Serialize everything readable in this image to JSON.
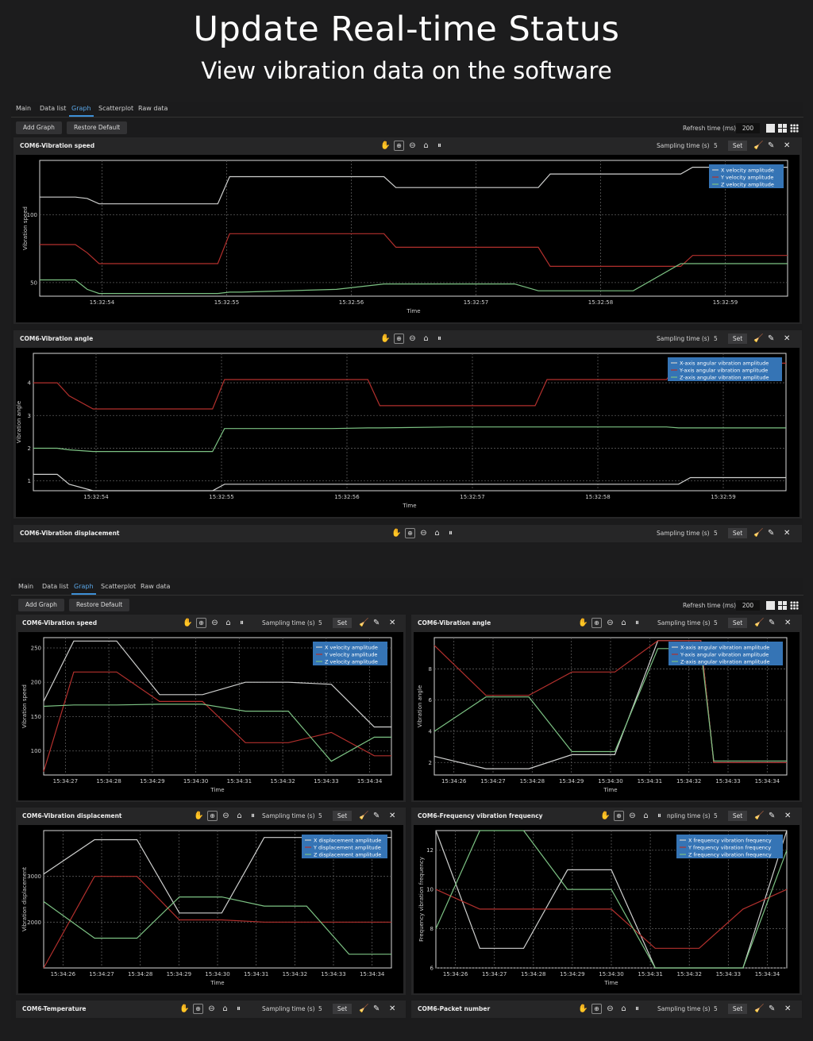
{
  "header": {
    "title": "Update Real-time Status",
    "subtitle": "View vibration data on the software"
  },
  "tabs": [
    "Main",
    "Data list",
    "Graph",
    "Scatterplot",
    "Raw data"
  ],
  "active_tab": "Graph",
  "toolbar": {
    "add_graph": "Add Graph",
    "restore_default": "Restore Default",
    "refresh_label": "Refresh time (ms)",
    "refresh_value": "200"
  },
  "panel_common": {
    "sampling_label": "Sampling time (s)",
    "sampling_value": "5",
    "set_label": "Set",
    "time_axis_label": "Time"
  },
  "top_panels": {
    "speed_title": "COM6-Vibration speed",
    "angle_title": "COM6-Vibration angle",
    "displacement_title": "COM6-Vibration displacement"
  },
  "bottom_panels": {
    "speed_title": "COM6-Vibration speed",
    "angle_title": "COM6-Vibration angle",
    "displacement_title": "COM6-Vibration displacement",
    "frequency_title": "COM6-Frequency vibration frequency",
    "frequency_sampling_label": "npling time (s)",
    "temperature_title": "COM6-Temperature",
    "packet_title": "COM6-Packet number"
  },
  "colors": {
    "x_series": "#cfd0cf",
    "y_series": "#b3302d",
    "z_series": "#7cc283",
    "legend_bg": "#3574b5",
    "accent_tab": "#3d8fd6"
  },
  "chart_data": [
    {
      "id": "top-speed",
      "type": "line",
      "ylabel": "Vibration speed",
      "xlabel": "Time",
      "x_ticks": [
        "15:32:54",
        "15:32:55",
        "15:32:56",
        "15:32:57",
        "15:32:58",
        "15:32:59"
      ],
      "y_ticks": [
        "50",
        "100"
      ],
      "legend": [
        "X velocity amplitude",
        "Y velocity amplitude",
        "Z velocity amplitude"
      ],
      "x": [
        53.5,
        53.8,
        53.9,
        54.0,
        54.5,
        55.0,
        55.1,
        55.2,
        56.0,
        56.4,
        56.5,
        57.0,
        57.5,
        57.7,
        57.8,
        58.0,
        58.4,
        58.5,
        58.9,
        59.0,
        59.5,
        59.8
      ],
      "ylim": [
        40,
        140
      ],
      "series": [
        {
          "name": "X velocity amplitude",
          "values": [
            113,
            113,
            112,
            108,
            108,
            108,
            128,
            128,
            128,
            128,
            120,
            120,
            120,
            120,
            130,
            130,
            130,
            130,
            130,
            135,
            135,
            135
          ]
        },
        {
          "name": "Y velocity amplitude",
          "values": [
            78,
            78,
            72,
            64,
            64,
            64,
            86,
            86,
            86,
            86,
            76,
            76,
            76,
            76,
            62,
            62,
            62,
            62,
            62,
            70,
            70,
            70
          ]
        },
        {
          "name": "Z velocity amplitude",
          "values": [
            52,
            52,
            45,
            42,
            42,
            42,
            43,
            43,
            45,
            49,
            49,
            49,
            49,
            44,
            44,
            44,
            44,
            44,
            64,
            64,
            64,
            64
          ]
        }
      ]
    },
    {
      "id": "top-angle",
      "type": "line",
      "ylabel": "Vibration angle",
      "xlabel": "Time",
      "x_ticks": [
        "15:32:54",
        "15:32:55",
        "15:32:56",
        "15:32:57",
        "15:32:58",
        "15:32:59"
      ],
      "y_ticks": [
        "1",
        "2",
        "3",
        "4"
      ],
      "legend": [
        "X-axis angular vibration amplitude",
        "Y-axis angular vibration amplitude",
        "Z-axis angular vibration amplitude"
      ],
      "x": [
        53.5,
        53.7,
        53.8,
        54.0,
        54.5,
        55.0,
        55.1,
        55.2,
        56.0,
        56.3,
        56.4,
        57.0,
        57.5,
        57.7,
        57.8,
        58.0,
        58.5,
        58.8,
        58.9,
        59.0,
        59.5,
        59.8
      ],
      "ylim": [
        0.7,
        4.9
      ],
      "series": [
        {
          "name": "X-axis angular vibration amplitude",
          "values": [
            1.2,
            1.2,
            0.9,
            0.7,
            0.7,
            0.7,
            0.9,
            0.9,
            0.9,
            0.9,
            0.9,
            0.9,
            0.9,
            0.9,
            0.9,
            0.9,
            0.9,
            0.9,
            0.9,
            1.1,
            1.1,
            1.1
          ]
        },
        {
          "name": "Y-axis angular vibration amplitude",
          "values": [
            4.0,
            4.0,
            3.6,
            3.2,
            3.2,
            3.2,
            4.1,
            4.1,
            4.1,
            4.1,
            3.3,
            3.3,
            3.3,
            3.3,
            4.1,
            4.1,
            4.1,
            4.1,
            4.6,
            4.6,
            4.6,
            4.6
          ]
        },
        {
          "name": "Z-axis angular vibration amplitude",
          "values": [
            2.0,
            2.0,
            1.95,
            1.9,
            1.9,
            1.9,
            2.6,
            2.6,
            2.6,
            2.62,
            2.62,
            2.65,
            2.65,
            2.65,
            2.65,
            2.65,
            2.65,
            2.65,
            2.62,
            2.62,
            2.62,
            2.62
          ]
        }
      ]
    },
    {
      "id": "bottom-speed",
      "type": "line",
      "ylabel": "Vibration speed",
      "xlabel": "Time",
      "x_ticks": [
        "15:34:27",
        "15:34:28",
        "15:34:29",
        "15:34:30",
        "15:34:31",
        "15:34:32",
        "15:34:33",
        "15:34:34"
      ],
      "y_ticks": [
        "100",
        "150",
        "200",
        "250"
      ],
      "legend": [
        "X velocity amplitude",
        "Y velocity amplitude",
        "Z velocity amplitude"
      ],
      "x": [
        26.5,
        27.2,
        28.2,
        29.2,
        30.2,
        31.2,
        32.2,
        33.2,
        34.2,
        34.6
      ],
      "ylim": [
        65,
        265
      ],
      "series": [
        {
          "name": "X velocity amplitude",
          "values": [
            172,
            260,
            260,
            182,
            182,
            200,
            200,
            197,
            135,
            135
          ]
        },
        {
          "name": "Y velocity amplitude",
          "values": [
            70,
            215,
            215,
            172,
            172,
            112,
            112,
            127,
            93,
            93
          ]
        },
        {
          "name": "Z velocity amplitude",
          "values": [
            165,
            167,
            167,
            168,
            168,
            158,
            158,
            85,
            120,
            120
          ]
        }
      ]
    },
    {
      "id": "bottom-angle",
      "type": "line",
      "ylabel": "Vibration angle",
      "xlabel": "Time",
      "x_ticks": [
        "15:34:26",
        "15:34:27",
        "15:34:28",
        "15:34:29",
        "15:34:30",
        "15:34:31",
        "15:34:32",
        "15:34:33",
        "15:34:34"
      ],
      "y_ticks": [
        "2",
        "4",
        "6",
        "8"
      ],
      "legend": [
        "X-axis angular vibration amplitude",
        "Y-axis angular vibration amplitude",
        "Z-axis angular vibration amplitude"
      ],
      "x": [
        26.0,
        27.2,
        28.2,
        29.2,
        30.2,
        31.2,
        32.2,
        32.5,
        33.2,
        34.2
      ],
      "ylim": [
        1.2,
        10
      ],
      "series": [
        {
          "name": "X-axis angular vibration amplitude",
          "values": [
            2.4,
            1.6,
            1.6,
            2.5,
            2.5,
            9.8,
            9.8,
            2.0,
            2.0,
            2.0
          ]
        },
        {
          "name": "Y-axis angular vibration amplitude",
          "values": [
            9.5,
            6.3,
            6.3,
            7.8,
            7.8,
            9.8,
            9.8,
            2.0,
            2.0,
            2.0
          ]
        },
        {
          "name": "Z-axis angular vibration amplitude",
          "values": [
            4.0,
            6.2,
            6.2,
            2.7,
            2.7,
            9.3,
            9.3,
            2.1,
            2.1,
            2.1
          ]
        }
      ]
    },
    {
      "id": "bottom-displacement",
      "type": "line",
      "ylabel": "Vibration displacement",
      "xlabel": "Time",
      "x_ticks": [
        "15:34:26",
        "15:34:27",
        "15:34:28",
        "15:34:29",
        "15:34:30",
        "15:34:31",
        "15:34:32",
        "15:34:33",
        "15:34:34"
      ],
      "y_ticks": [
        "2000",
        "3000"
      ],
      "legend": [
        "X displacement amplitude",
        "Y displacement amplitude",
        "Z displacement amplitude"
      ],
      "x": [
        26.0,
        27.2,
        28.2,
        29.2,
        30.2,
        31.2,
        32.2,
        33.2,
        34.2
      ],
      "ylim": [
        1000,
        4000
      ],
      "series": [
        {
          "name": "X displacement amplitude",
          "values": [
            3050,
            3800,
            3800,
            2200,
            2200,
            3850,
            3850,
            3850,
            3850
          ]
        },
        {
          "name": "Y displacement amplitude",
          "values": [
            1000,
            3000,
            3000,
            2050,
            2050,
            2000,
            2000,
            2000,
            2000
          ]
        },
        {
          "name": "Z displacement amplitude",
          "values": [
            2450,
            1650,
            1650,
            2550,
            2550,
            2350,
            2350,
            1300,
            1300
          ]
        }
      ]
    },
    {
      "id": "bottom-frequency",
      "type": "line",
      "ylabel": "Frequency vibration frequency",
      "xlabel": "Time",
      "x_ticks": [
        "15:34:26",
        "15:34:27",
        "15:34:28",
        "15:34:29",
        "15:34:30",
        "15:34:31",
        "15:34:32",
        "15:34:33",
        "15:34:34"
      ],
      "y_ticks": [
        "6",
        "8",
        "10",
        "12"
      ],
      "legend": [
        "X frequency vibration frequency",
        "Y frequency vibration frequency",
        "Z frequency vibration frequency"
      ],
      "x": [
        26.0,
        27.0,
        28.0,
        29.0,
        30.0,
        31.0,
        32.0,
        33.0,
        34.0
      ],
      "ylim": [
        6,
        13
      ],
      "series": [
        {
          "name": "X frequency vibration frequency",
          "values": [
            13,
            7,
            7,
            11,
            11,
            6,
            6,
            6,
            13
          ]
        },
        {
          "name": "Y frequency vibration frequency",
          "values": [
            10,
            9,
            9,
            9,
            9,
            7,
            7,
            9,
            10
          ]
        },
        {
          "name": "Z frequency vibration frequency",
          "values": [
            8,
            13,
            13,
            10,
            10,
            6,
            6,
            6,
            12
          ]
        }
      ]
    }
  ]
}
